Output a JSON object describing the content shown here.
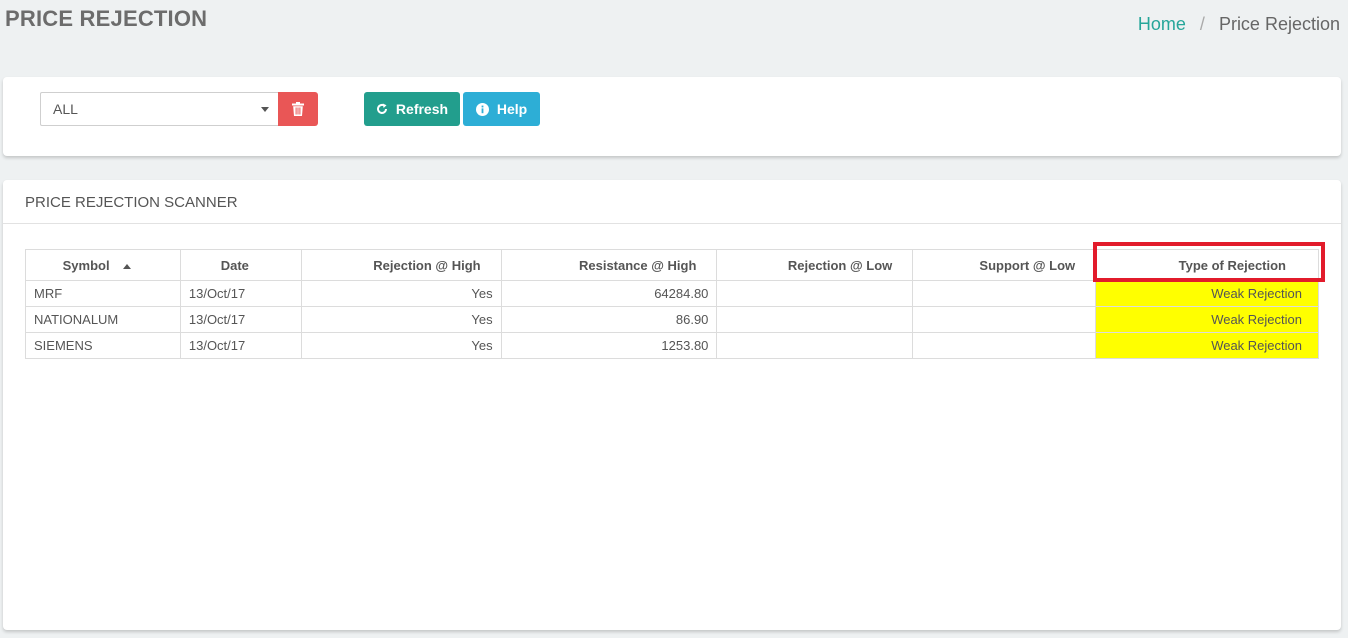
{
  "header": {
    "title": "PRICE REJECTION",
    "breadcrumb": {
      "home": "Home",
      "separator": "/",
      "current": "Price Rejection"
    }
  },
  "filter": {
    "select_value": "ALL",
    "delete_icon": "trash-icon",
    "refresh_label": "Refresh",
    "refresh_icon": "refresh-icon",
    "help_label": "Help",
    "help_icon": "info-icon"
  },
  "scanner": {
    "title": "PRICE REJECTION SCANNER",
    "columns": [
      "Symbol",
      "Date",
      "Rejection @ High",
      "Resistance @ High",
      "Rejection @ Low",
      "Support @ Low",
      "Type of Rejection"
    ],
    "rows": [
      {
        "symbol": "MRF",
        "date": "13/Oct/17",
        "rejection_high": "Yes",
        "resistance_high": "64284.80",
        "rejection_low": "",
        "support_low": "",
        "type": "Weak Rejection"
      },
      {
        "symbol": "NATIONALUM",
        "date": "13/Oct/17",
        "rejection_high": "Yes",
        "resistance_high": "86.90",
        "rejection_low": "",
        "support_low": "",
        "type": "Weak Rejection"
      },
      {
        "symbol": "SIEMENS",
        "date": "13/Oct/17",
        "rejection_high": "Yes",
        "resistance_high": "1253.80",
        "rejection_low": "",
        "support_low": "",
        "type": "Weak Rejection"
      }
    ]
  },
  "colors": {
    "accent_teal": "#229e8d",
    "danger": "#e95656",
    "info": "#2daed6",
    "highlight_yellow": "#ffff00",
    "annotation_red": "#e21b2b"
  }
}
